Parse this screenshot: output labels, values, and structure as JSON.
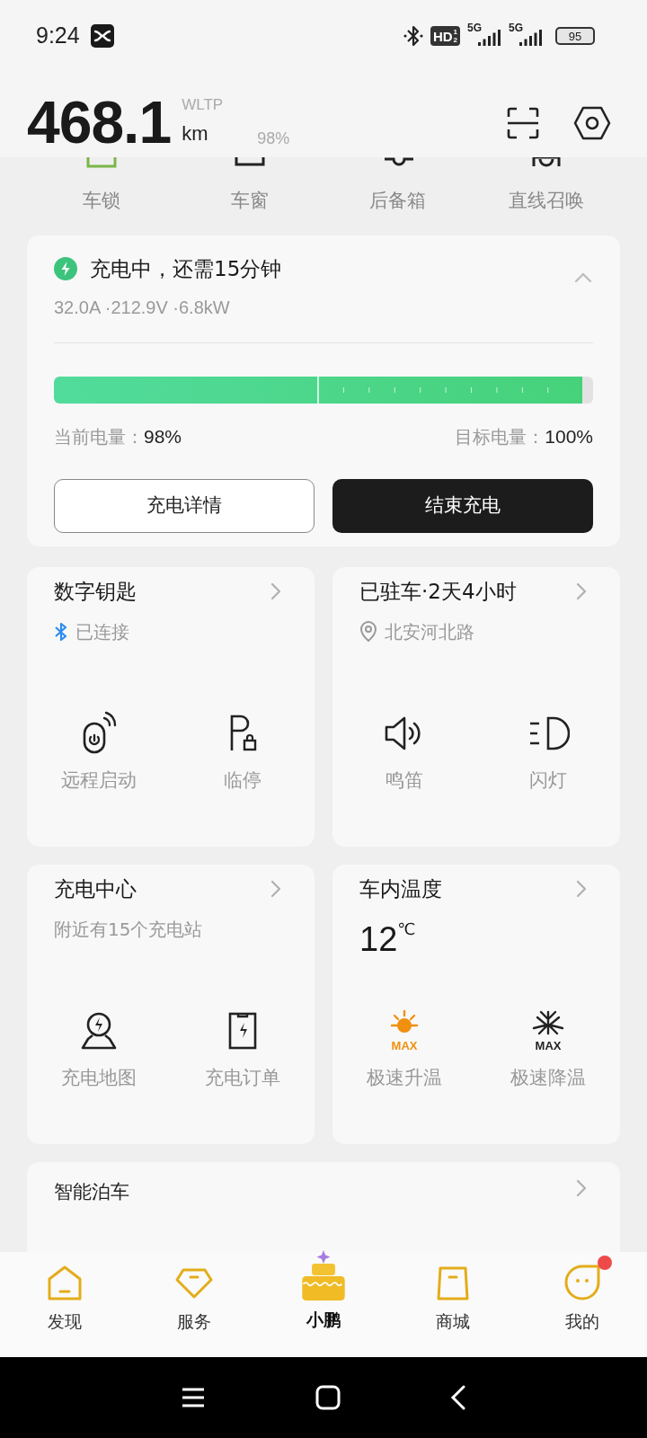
{
  "status_bar": {
    "time": "9:24",
    "hd": "HD",
    "hd_slots": [
      "1",
      "2"
    ],
    "networks": [
      "5G",
      "5G"
    ],
    "battery": "95"
  },
  "range": {
    "value": "468.1",
    "standard": "WLTP",
    "unit": "km",
    "battery": "98%"
  },
  "quick_actions": [
    {
      "label": "车锁"
    },
    {
      "label": "车窗"
    },
    {
      "label": "后备箱"
    },
    {
      "label": "直线召唤"
    }
  ],
  "charging": {
    "title": "充电中，还需15分钟",
    "stats": "32.0A ·212.9V ·6.8kW",
    "expanded": true,
    "level": 0.98,
    "current_label": "当前电量：",
    "current": "98%",
    "target_label": "目标电量：",
    "target": "100%",
    "buttons": [
      {
        "label": "充电详情",
        "kind": "outline"
      },
      {
        "label": "结束充电",
        "kind": "solid"
      }
    ]
  },
  "cards": [
    {
      "kind": "key",
      "title": "数字钥匙",
      "subtitle": "已连接",
      "actions": [
        {
          "label": "远程启动"
        },
        {
          "label": "临停"
        }
      ]
    },
    {
      "kind": "parking",
      "title": "已驻车·2天4小时",
      "subtitle": "北安河北路",
      "actions": [
        {
          "label": "鸣笛"
        },
        {
          "label": "闪灯"
        }
      ]
    },
    {
      "kind": "charging",
      "title": "充电中心",
      "subtitle": "附近有15个充电站",
      "actions": [
        {
          "label": "充电地图"
        },
        {
          "label": "充电订单"
        }
      ]
    },
    {
      "kind": "climate",
      "title": "车内温度",
      "value": "12",
      "unit": "℃",
      "actions": [
        {
          "label": "极速升温",
          "icon_text": "MAX"
        },
        {
          "label": "极速降温",
          "icon_text": "MAX"
        }
      ]
    }
  ],
  "parking_card": {
    "title": "智能泊车"
  },
  "tabs": [
    {
      "label": "发现",
      "selected": false,
      "badge": false
    },
    {
      "label": "服务",
      "selected": false,
      "badge": false
    },
    {
      "label": "小鹏",
      "selected": true,
      "badge": false
    },
    {
      "label": "商城",
      "selected": false,
      "badge": false
    },
    {
      "label": "我的",
      "selected": false,
      "badge": true
    }
  ]
}
